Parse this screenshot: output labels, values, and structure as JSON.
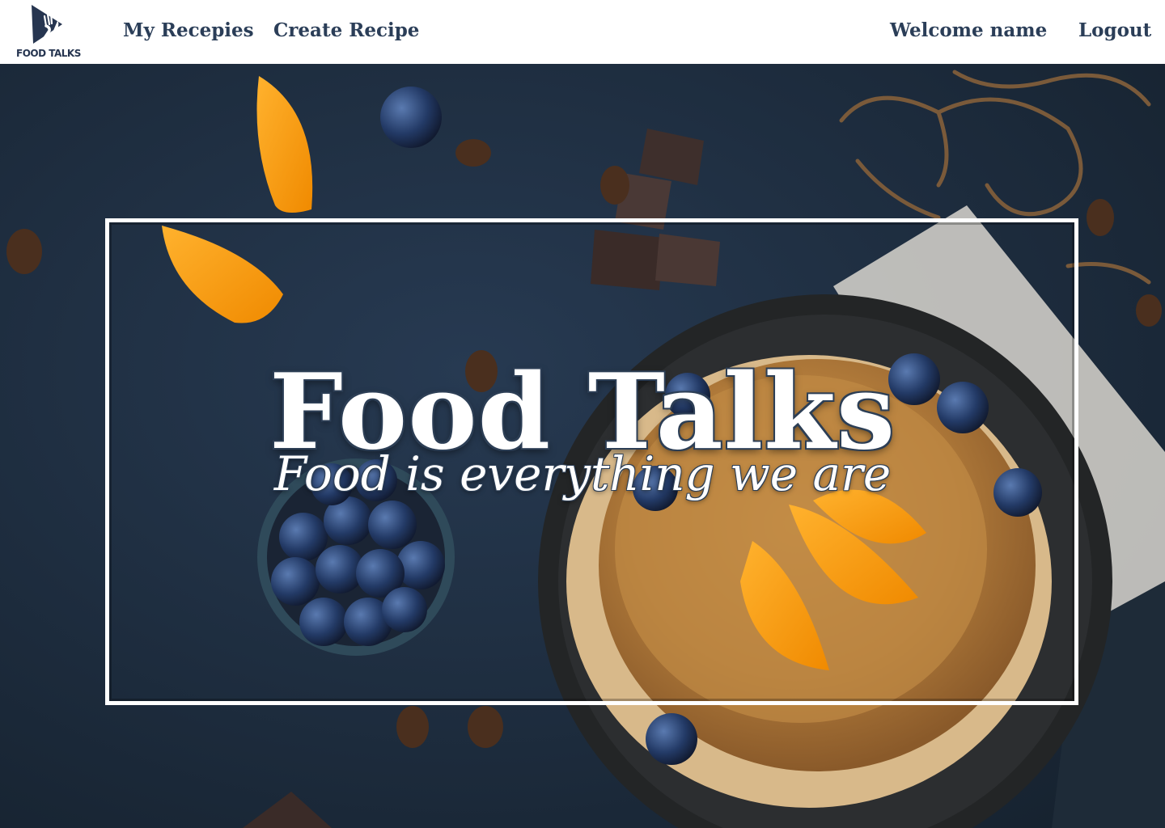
{
  "brand": {
    "logo_text": "FOOD TALKS",
    "logo_icon": "fork-knife-icon",
    "color": "#263550"
  },
  "nav": {
    "my_recipes": "My Recepies",
    "create_recipe": "Create Recipe",
    "welcome": "Welcome name",
    "logout": "Logout"
  },
  "hero": {
    "title": "Food Talks",
    "tagline": "Food is everything we are",
    "background": "pancakes-blueberries-oranges-photo"
  },
  "colors": {
    "nav_text": "#2b3e58",
    "background": "#1c2a3c",
    "frame": "#ffffff"
  }
}
